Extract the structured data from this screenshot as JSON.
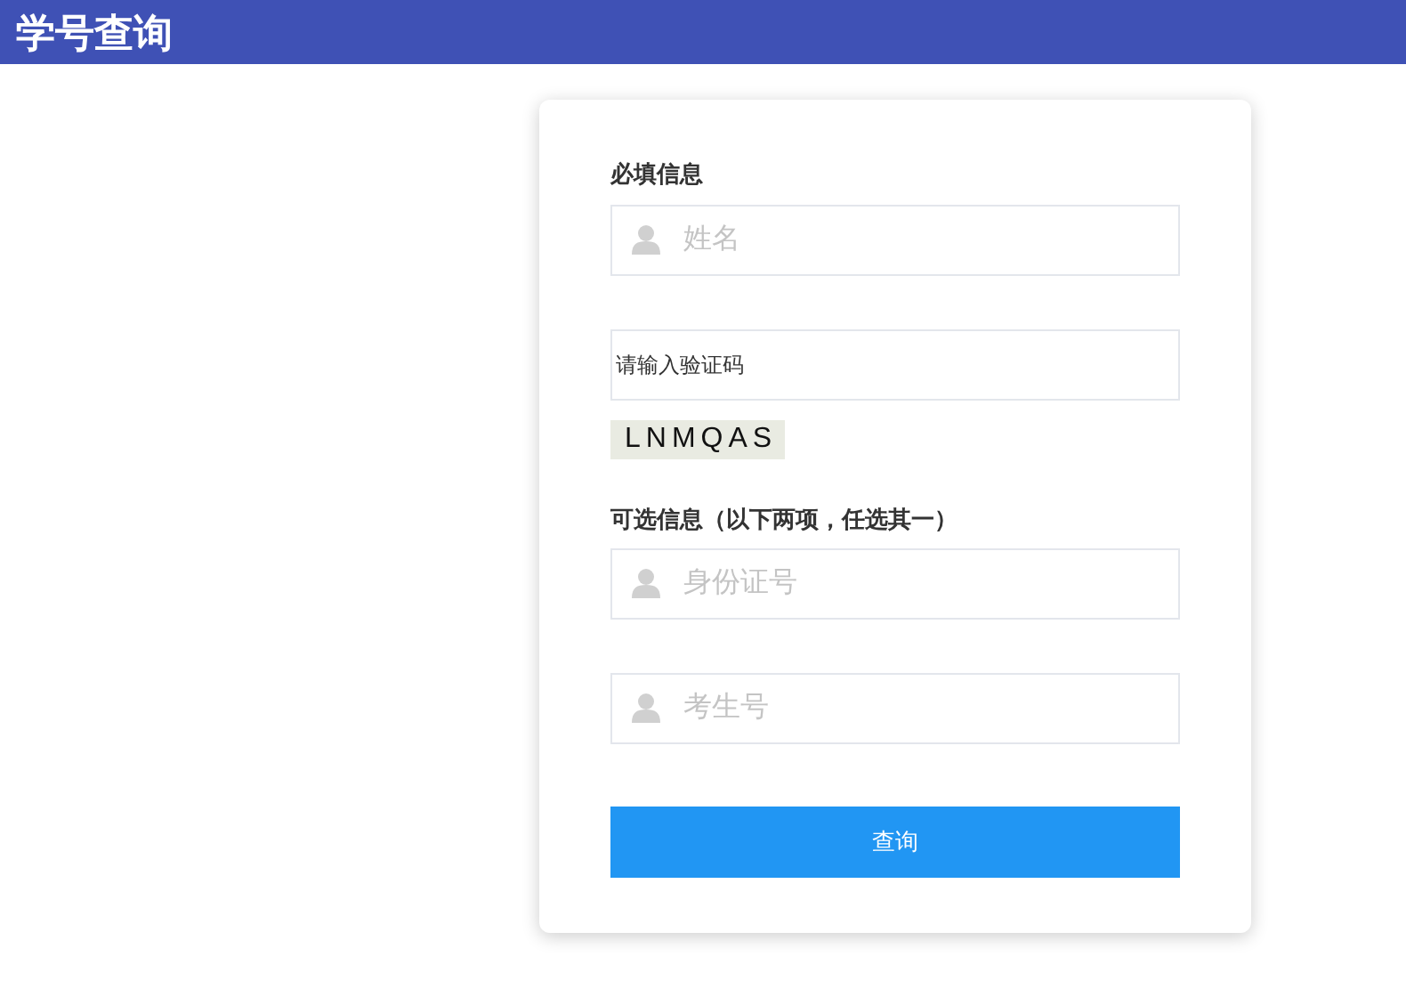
{
  "header": {
    "title": "学号查询"
  },
  "sections": [
    {
      "label": "必填信息",
      "fields": [
        {
          "kind": "icon",
          "placeholder": "姓名"
        },
        {
          "kind": "captcha",
          "placeholder": "请输入验证码",
          "captcha": "LNMQAS"
        }
      ]
    },
    {
      "label": "可选信息（以下两项，任选其一）",
      "fields": [
        {
          "kind": "icon",
          "placeholder": "身份证号"
        },
        {
          "kind": "icon",
          "placeholder": "考生号"
        }
      ]
    }
  ],
  "submit": "查询"
}
